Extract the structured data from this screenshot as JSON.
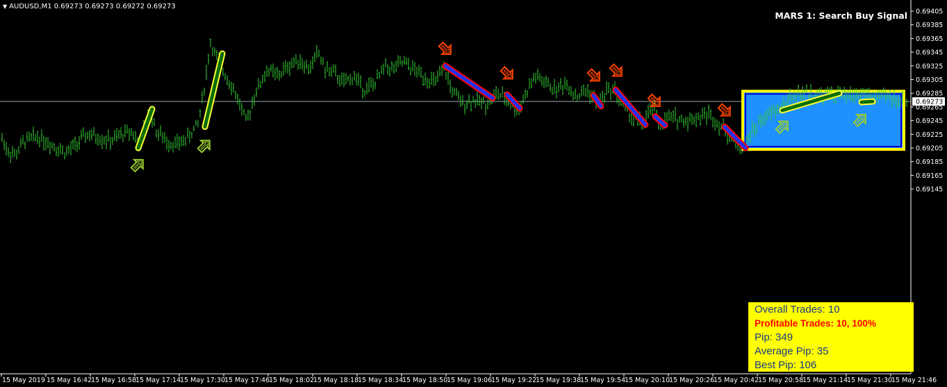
{
  "header": {
    "symbol_info": "AUDUSD,M1  0.69273 0.69273 0.69272 0.69273",
    "signal_title": "MARS 1: Search Buy Signal"
  },
  "stats": {
    "overall_trades": "Overall Trades: 10",
    "profitable_trades": "Profitable Trades: 10, 100%",
    "pip": "Pip: 349",
    "average_pip": "Average Pip: 35",
    "best_pip": "Best Pip: 106"
  },
  "chart_data": {
    "type": "ohlc",
    "instrument": "AUDUSD",
    "timeframe": "M1",
    "current_price": "0.69273",
    "y_ticks": [
      "0.69405",
      "0.69385",
      "0.69365",
      "0.69345",
      "0.69325",
      "0.69305",
      "0.69285",
      "0.69265",
      "0.69245",
      "0.69225",
      "0.69205",
      "0.69185",
      "0.69165",
      "0.69145"
    ],
    "x_ticks": [
      "15 May 2019",
      "15 May 16:42",
      "15 May 16:58",
      "15 May 17:14",
      "15 May 17:30",
      "15 May 17:46",
      "15 May 18:02",
      "15 May 18:18",
      "15 May 18:34",
      "15 May 18:50",
      "15 May 19:06",
      "15 May 19:22",
      "15 May 19:38",
      "15 May 19:54",
      "15 May 20:10",
      "15 May 20:26",
      "15 May 20:42",
      "15 May 20:58",
      "15 May 21:14",
      "15 May 21:30",
      "15 May 21:46"
    ],
    "price_path": [
      [
        0,
        0.69225
      ],
      [
        12,
        0.692
      ],
      [
        22,
        0.69195
      ],
      [
        35,
        0.69215
      ],
      [
        55,
        0.69222
      ],
      [
        75,
        0.6921
      ],
      [
        95,
        0.69198
      ],
      [
        110,
        0.6921
      ],
      [
        125,
        0.69225
      ],
      [
        145,
        0.6922
      ],
      [
        160,
        0.69215
      ],
      [
        175,
        0.69225
      ],
      [
        190,
        0.6923
      ],
      [
        200,
        0.6921
      ],
      [
        205,
        0.69225
      ],
      [
        215,
        0.6926
      ],
      [
        225,
        0.6923
      ],
      [
        240,
        0.69215
      ],
      [
        255,
        0.6921
      ],
      [
        270,
        0.6922
      ],
      [
        285,
        0.6924
      ],
      [
        295,
        0.693
      ],
      [
        303,
        0.6936
      ],
      [
        310,
        0.6934
      ],
      [
        320,
        0.6932
      ],
      [
        332,
        0.693
      ],
      [
        345,
        0.6927
      ],
      [
        355,
        0.6924
      ],
      [
        365,
        0.6928
      ],
      [
        375,
        0.693
      ],
      [
        385,
        0.6932
      ],
      [
        400,
        0.6931
      ],
      [
        415,
        0.69325
      ],
      [
        430,
        0.69335
      ],
      [
        445,
        0.6932
      ],
      [
        458,
        0.69345
      ],
      [
        468,
        0.6932
      ],
      [
        480,
        0.69315
      ],
      [
        495,
        0.693
      ],
      [
        510,
        0.6931
      ],
      [
        525,
        0.6929
      ],
      [
        540,
        0.693
      ],
      [
        555,
        0.69325
      ],
      [
        565,
        0.6932
      ],
      [
        580,
        0.6933
      ],
      [
        595,
        0.6932
      ],
      [
        610,
        0.6931
      ],
      [
        625,
        0.693
      ],
      [
        640,
        0.6932
      ],
      [
        650,
        0.6929
      ],
      [
        665,
        0.6927
      ],
      [
        680,
        0.69275
      ],
      [
        700,
        0.6927
      ],
      [
        715,
        0.69285
      ],
      [
        730,
        0.69275
      ],
      [
        745,
        0.6926
      ],
      [
        760,
        0.6929
      ],
      [
        770,
        0.6931
      ],
      [
        785,
        0.693
      ],
      [
        800,
        0.6929
      ],
      [
        815,
        0.693
      ],
      [
        830,
        0.6928
      ],
      [
        845,
        0.6929
      ],
      [
        860,
        0.6927
      ],
      [
        875,
        0.6929
      ],
      [
        885,
        0.6929
      ],
      [
        895,
        0.6927
      ],
      [
        910,
        0.6925
      ],
      [
        925,
        0.6924
      ],
      [
        940,
        0.69265
      ],
      [
        950,
        0.6924
      ],
      [
        965,
        0.6925
      ],
      [
        985,
        0.69245
      ],
      [
        1005,
        0.6925
      ],
      [
        1020,
        0.69255
      ],
      [
        1030,
        0.69245
      ],
      [
        1045,
        0.6923
      ],
      [
        1060,
        0.6921
      ],
      [
        1070,
        0.69205
      ],
      [
        1080,
        0.69225
      ],
      [
        1095,
        0.69245
      ],
      [
        1110,
        0.69255
      ],
      [
        1125,
        0.69265
      ],
      [
        1140,
        0.6928
      ],
      [
        1160,
        0.69285
      ],
      [
        1180,
        0.6928
      ],
      [
        1200,
        0.69285
      ],
      [
        1220,
        0.6928
      ],
      [
        1240,
        0.69285
      ],
      [
        1260,
        0.69278
      ],
      [
        1280,
        0.6928
      ],
      [
        1300,
        0.69273
      ]
    ],
    "buy_trades": [
      {
        "x1": 199,
        "y1": 0.69205,
        "x2": 219,
        "y2": 0.69262
      },
      {
        "x1": 295,
        "y1": 0.69236,
        "x2": 320,
        "y2": 0.69343
      },
      {
        "x1": 1126,
        "y1": 0.6926,
        "x2": 1208,
        "y2": 0.69285
      },
      {
        "x1": 1240,
        "y1": 0.69272,
        "x2": 1256,
        "y2": 0.69273
      }
    ],
    "sell_trades": [
      {
        "x1": 641,
        "y1": 0.69325,
        "x2": 709,
        "y2": 0.69278
      },
      {
        "x1": 730,
        "y1": 0.69283,
        "x2": 748,
        "y2": 0.69263
      },
      {
        "x1": 854,
        "y1": 0.69282,
        "x2": 865,
        "y2": 0.69266
      },
      {
        "x1": 886,
        "y1": 0.6929,
        "x2": 929,
        "y2": 0.69239
      },
      {
        "x1": 943,
        "y1": 0.69251,
        "x2": 957,
        "y2": 0.69238
      },
      {
        "x1": 1043,
        "y1": 0.69236,
        "x2": 1073,
        "y2": 0.69205
      }
    ],
    "buy_arrows": [
      [
        198,
        0.6918
      ],
      [
        294,
        0.69208
      ],
      [
        1126,
        0.69236
      ],
      [
        1238,
        0.69246
      ]
    ],
    "sell_arrows": [
      [
        641,
        0.6935
      ],
      [
        730,
        0.69314
      ],
      [
        855,
        0.69311
      ],
      [
        887,
        0.69318
      ],
      [
        942,
        0.69274
      ],
      [
        1043,
        0.6926
      ]
    ],
    "signal_box": {
      "x_start": 1069,
      "x_end": 1301,
      "y_top": 0.69288,
      "y_bottom": 0.69203
    }
  },
  "colors": {
    "background": "#000000",
    "candles": "#33cc33",
    "buy_line": "#0a6e0a",
    "buy_outline": "#ffff33",
    "sell_line": "#2233ee",
    "sell_outline": "#ff0000",
    "signal_box_fill": "#1e90ff",
    "signal_box_border": "#ffff00",
    "sell_arrow": "#ff4500",
    "buy_arrow": "#9acd32",
    "stats_bg": "#ffff00"
  }
}
